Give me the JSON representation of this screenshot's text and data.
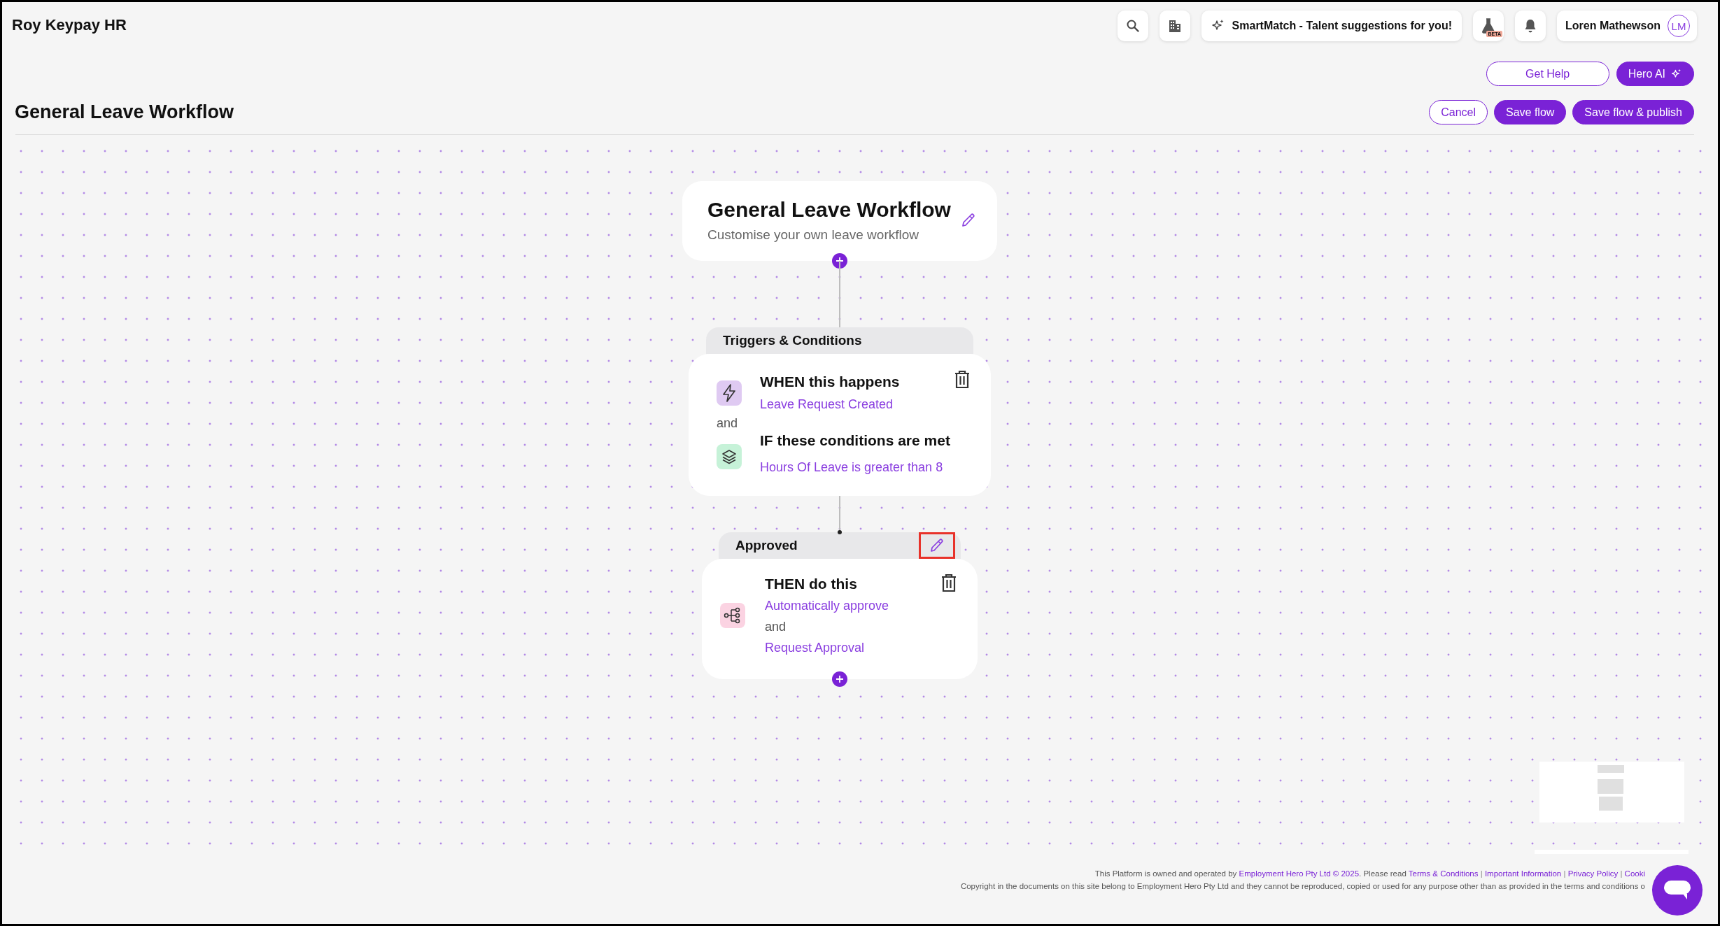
{
  "header": {
    "org_name": "Roy Keypay HR",
    "toolbar": [
      {
        "kind": "search"
      },
      {
        "kind": "building"
      },
      {
        "kind": "smartmatch",
        "label": "SmartMatch - Talent suggestions for you!"
      },
      {
        "kind": "beta",
        "badge": "BETA"
      },
      {
        "kind": "bell"
      },
      {
        "kind": "user",
        "label": "Loren Mathewson",
        "initials": "LM"
      }
    ]
  },
  "help_buttons": [
    {
      "label": "Get Help",
      "kind": "outline"
    },
    {
      "label": "Hero AI",
      "kind": "ai"
    }
  ],
  "page": {
    "title": "General Leave Workflow",
    "actions": [
      {
        "label": "Cancel",
        "kind": "outline"
      },
      {
        "label": "Save flow",
        "kind": "filled"
      },
      {
        "label": "Save flow & publish",
        "kind": "filled"
      }
    ]
  },
  "workflow": {
    "start": {
      "title": "General Leave Workflow",
      "subtitle": "Customise your own leave workflow"
    },
    "trigger_block": {
      "header": "Triggers & Conditions",
      "when_title": "WHEN this happens",
      "when_value": "Leave Request Created",
      "joiner": "and",
      "if_title": "IF these conditions are met",
      "if_value": "Hours Of Leave is greater than 8"
    },
    "action_block": {
      "header": "Approved",
      "edit_highlighted": true,
      "title": "THEN do this",
      "joiner": "and",
      "actions": [
        "Automatically approve",
        "Request Approval"
      ]
    }
  },
  "footer": {
    "line1": [
      {
        "kind": "text",
        "text": "This Platform is owned and operated by "
      },
      {
        "kind": "link",
        "text": "Employment Hero Pty Ltd © 2025"
      },
      {
        "kind": "text",
        "text": ". Please read "
      },
      {
        "kind": "link",
        "text": "Terms & Conditions"
      },
      {
        "kind": "separator",
        "text": " | "
      },
      {
        "kind": "link",
        "text": "Important Information"
      },
      {
        "kind": "separator",
        "text": " | "
      },
      {
        "kind": "link",
        "text": "Privacy Policy"
      },
      {
        "kind": "separator",
        "text": " | "
      },
      {
        "kind": "link",
        "text": "Cooki"
      }
    ],
    "line2": "Copyright in the documents on this site belong to Employment Hero Pty Ltd and they cannot be reproduced, copied or used for any purpose other than as provided in the terms and conditions o"
  }
}
